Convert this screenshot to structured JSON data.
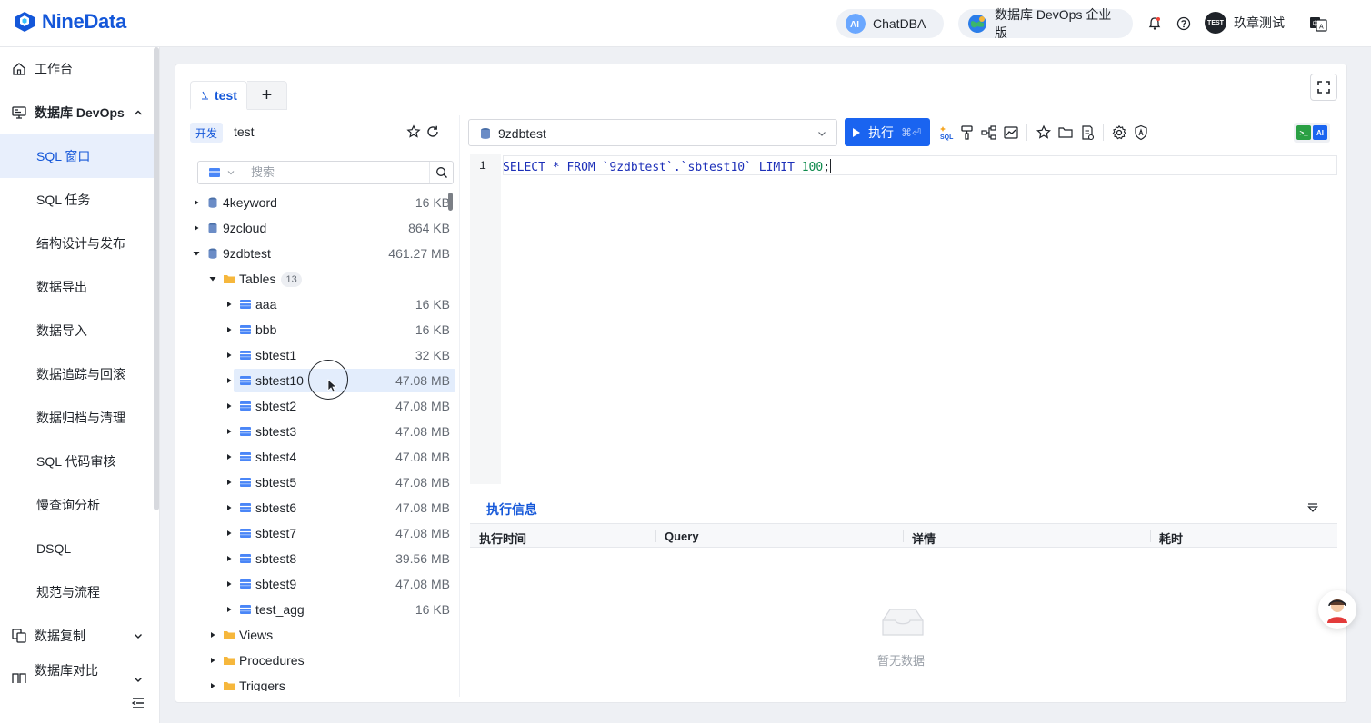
{
  "brand": {
    "name": "NineData"
  },
  "header": {
    "chatdba_label": "ChatDBA",
    "edition_label": "数据库 DevOps 企业版",
    "user_name": "玖章测试",
    "avatar_text": "TEST"
  },
  "nav": {
    "items": [
      {
        "label": "工作台",
        "icon": "home-icon"
      },
      {
        "label": "数据库 DevOps",
        "icon": "monitor-icon",
        "expanded": true
      },
      {
        "label": "SQL 窗口",
        "active": true
      },
      {
        "label": "SQL 任务"
      },
      {
        "label": "结构设计与发布"
      },
      {
        "label": "数据导出"
      },
      {
        "label": "数据导入"
      },
      {
        "label": "数据追踪与回滚"
      },
      {
        "label": "数据归档与清理"
      },
      {
        "label": "SQL 代码审核"
      },
      {
        "label": "慢查询分析"
      },
      {
        "label": "DSQL"
      },
      {
        "label": "规范与流程"
      },
      {
        "label": "数据复制",
        "icon": "copy-icon"
      },
      {
        "label": "数据库对比",
        "icon": "compare-icon"
      }
    ]
  },
  "tabs": {
    "active_label": "test",
    "add_label": "+"
  },
  "datasource": {
    "env_tag": "开发",
    "name": "test"
  },
  "search": {
    "placeholder": "搜索"
  },
  "tree": {
    "databases": [
      {
        "name": "4keyword",
        "size": "16 KB"
      },
      {
        "name": "9zcloud",
        "size": "864 KB"
      },
      {
        "name": "9zdbtest",
        "size": "461.27 MB"
      }
    ],
    "tables_folder": {
      "label": "Tables",
      "count": "13"
    },
    "tables": [
      {
        "name": "aaa",
        "size": "16 KB"
      },
      {
        "name": "bbb",
        "size": "16 KB"
      },
      {
        "name": "sbtest1",
        "size": "32 KB"
      },
      {
        "name": "sbtest10",
        "size": "47.08 MB",
        "selected": true
      },
      {
        "name": "sbtest2",
        "size": "47.08 MB"
      },
      {
        "name": "sbtest3",
        "size": "47.08 MB"
      },
      {
        "name": "sbtest4",
        "size": "47.08 MB"
      },
      {
        "name": "sbtest5",
        "size": "47.08 MB"
      },
      {
        "name": "sbtest6",
        "size": "47.08 MB"
      },
      {
        "name": "sbtest7",
        "size": "47.08 MB"
      },
      {
        "name": "sbtest8",
        "size": "39.56 MB"
      },
      {
        "name": "sbtest9",
        "size": "47.08 MB"
      },
      {
        "name": "test_agg",
        "size": "16 KB"
      }
    ],
    "folders": [
      "Views",
      "Procedures",
      "Triggers"
    ]
  },
  "editor": {
    "database": "9zdbtest",
    "run_label": "执行",
    "run_shortcut": "⌘⏎",
    "line_number": "1",
    "sql_prefix": "SELECT * FROM `9zdbtest`.`sbtest10` LIMIT ",
    "sql_limit": "100",
    "sql_suffix": ";"
  },
  "results": {
    "tab_label": "执行信息",
    "columns": [
      "执行时间",
      "Query",
      "详情",
      "耗时"
    ],
    "empty_text": "暂无数据"
  },
  "colors": {
    "accent": "#1457d9",
    "primary_button": "#1a64f0"
  }
}
